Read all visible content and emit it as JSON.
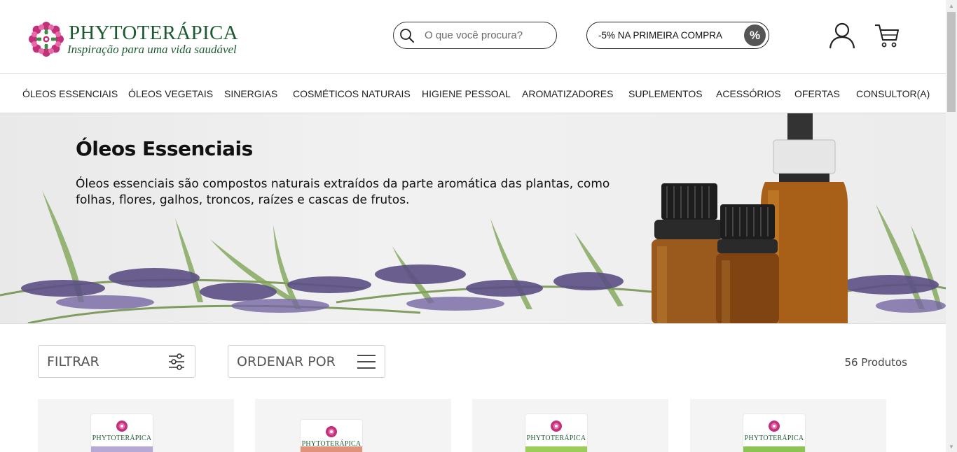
{
  "header": {
    "brand_name": "PHYTOTERÁPICA",
    "tagline": "Inspiração para uma vida saudável",
    "search_placeholder": "O que você procura?",
    "promo_label": "-5% NA PRIMEIRA COMPRA",
    "promo_badge": "%",
    "icons": {
      "search": "search-icon",
      "user": "user-icon",
      "cart": "cart-icon",
      "logo": "mandala-logo-icon"
    }
  },
  "nav": {
    "items": [
      "ÓLEOS ESSENCIAIS",
      "ÓLEOS VEGETAIS",
      "SINERGIAS",
      "COSMÉTICOS NATURAIS",
      "HIGIENE PESSOAL",
      "AROMATIZADORES",
      "SUPLEMENTOS",
      "ACESSÓRIOS",
      "OFERTAS",
      "CONSULTOR(A)"
    ]
  },
  "banner": {
    "title": "Óleos Essenciais",
    "description": "Óleos essenciais são compostos naturais extraídos da parte aromática das plantas, como folhas, flores, galhos, troncos, raízes e cascas de frutos."
  },
  "toolbar": {
    "filter_label": "FILTRAR",
    "sort_label": "ORDENAR POR",
    "count_text": "56 Produtos",
    "icons": {
      "filter": "sliders-icon",
      "sort": "menu-lines-icon"
    }
  },
  "products": [
    {
      "brand": "PHYTOTERÁPICA",
      "band_color": "#b7a9d6"
    },
    {
      "brand": "PHYTOTERÁPICA",
      "band_color": "#e0937a"
    },
    {
      "brand": "PHYTOTERÁPICA",
      "band_color": "#9ccc5a"
    },
    {
      "brand": "PHYTOTERÁPICA",
      "band_color": "#8cc454"
    }
  ],
  "colors": {
    "brand_green": "#1d5a32",
    "mandala_pink": "#c2307a",
    "border": "#d8d8d8"
  }
}
